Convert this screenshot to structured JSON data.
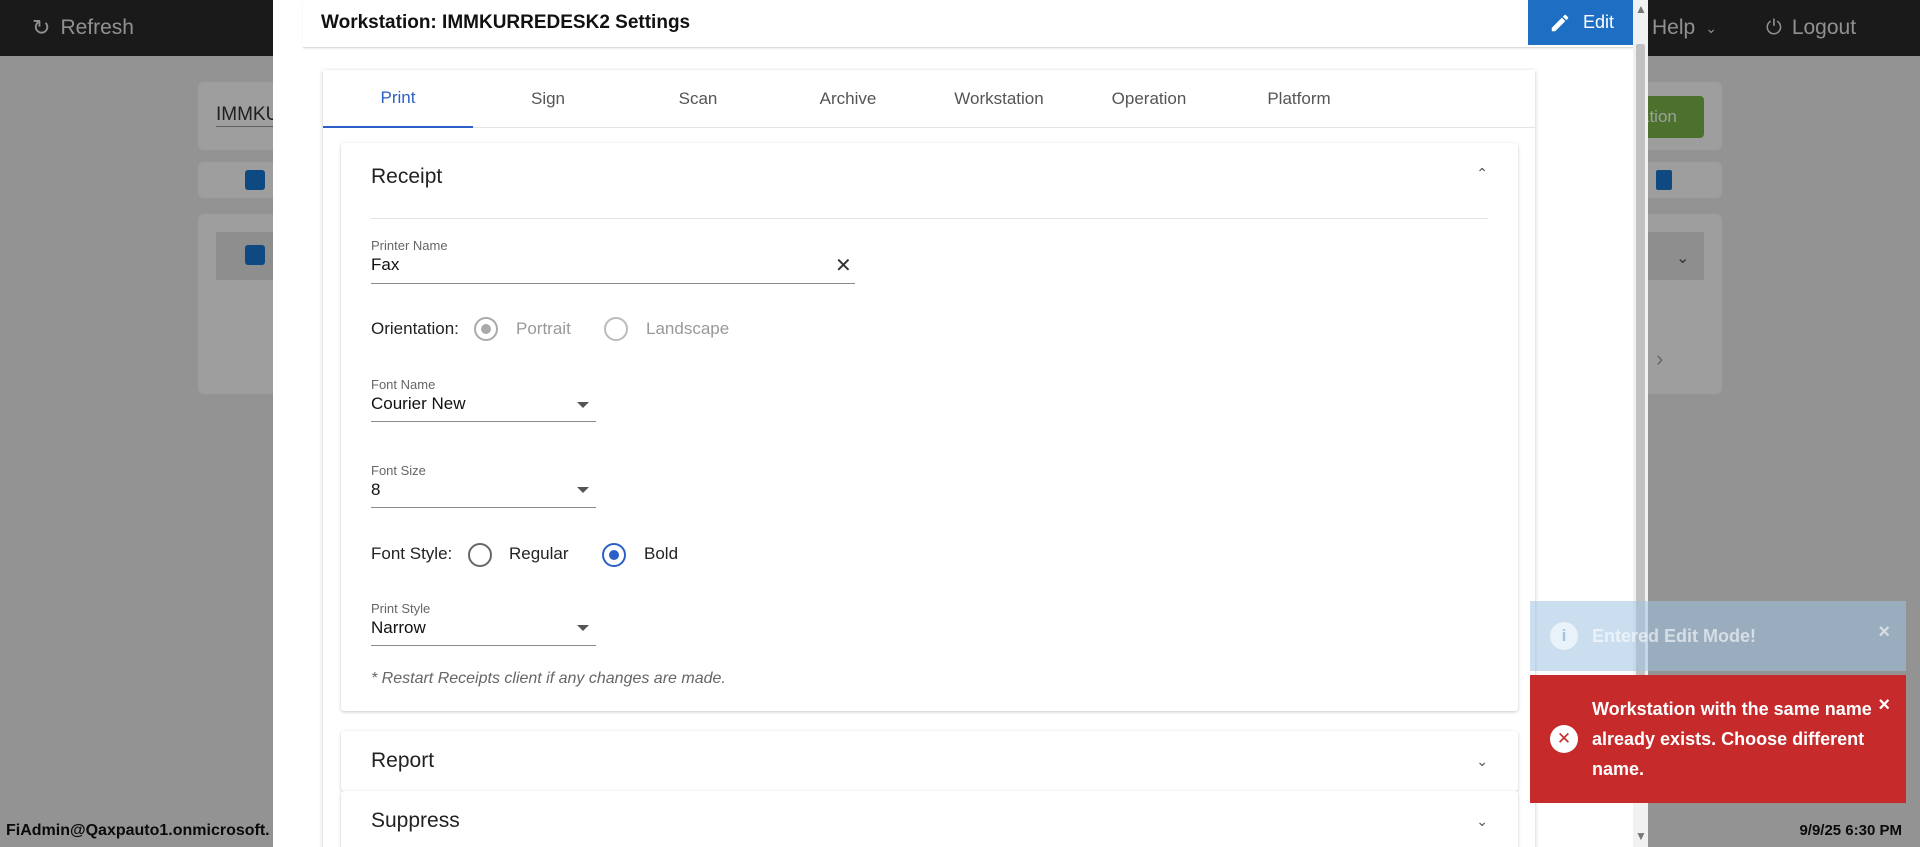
{
  "topbar": {
    "refresh_label": "Refresh",
    "help_label": "Help",
    "logout_label": "Logout"
  },
  "background": {
    "workstation_input_value": "IMMKU",
    "green_button_label": "ation"
  },
  "footer": {
    "user": "FiAdmin@Qaxpauto1.onmicrosoft.",
    "datetime": "9/9/25 6:30 PM"
  },
  "modal": {
    "title": "Workstation: IMMKURREDESK2 Settings",
    "edit_label": "Edit",
    "tabs": [
      "Print",
      "Sign",
      "Scan",
      "Archive",
      "Workstation",
      "Operation",
      "Platform"
    ],
    "active_tab": "Print",
    "receipt": {
      "title": "Receipt",
      "printer_name_label": "Printer Name",
      "printer_name_value": "Fax",
      "orientation_label": "Orientation:",
      "orientation_options": [
        "Portrait",
        "Landscape"
      ],
      "orientation_selected": "Portrait",
      "font_name_label": "Font Name",
      "font_name_value": "Courier New",
      "font_size_label": "Font Size",
      "font_size_value": "8",
      "font_style_label": "Font Style:",
      "font_style_options": [
        "Regular",
        "Bold"
      ],
      "font_style_selected": "Bold",
      "print_style_label": "Print Style",
      "print_style_value": "Narrow",
      "note": "* Restart Receipts client if any changes are made."
    },
    "report_title": "Report",
    "suppress_title": "Suppress"
  },
  "toasts": {
    "info": {
      "message": "Entered Edit Mode!",
      "icon": "info-icon"
    },
    "error": {
      "message": "Workstation with the same name already exists. Choose different name.",
      "icon": "error-icon"
    }
  },
  "colors": {
    "accent": "#2c5fc7",
    "edit_button": "#1e6fc4",
    "error_toast": "#c62a2a",
    "topbar": "#2b2b2b"
  }
}
